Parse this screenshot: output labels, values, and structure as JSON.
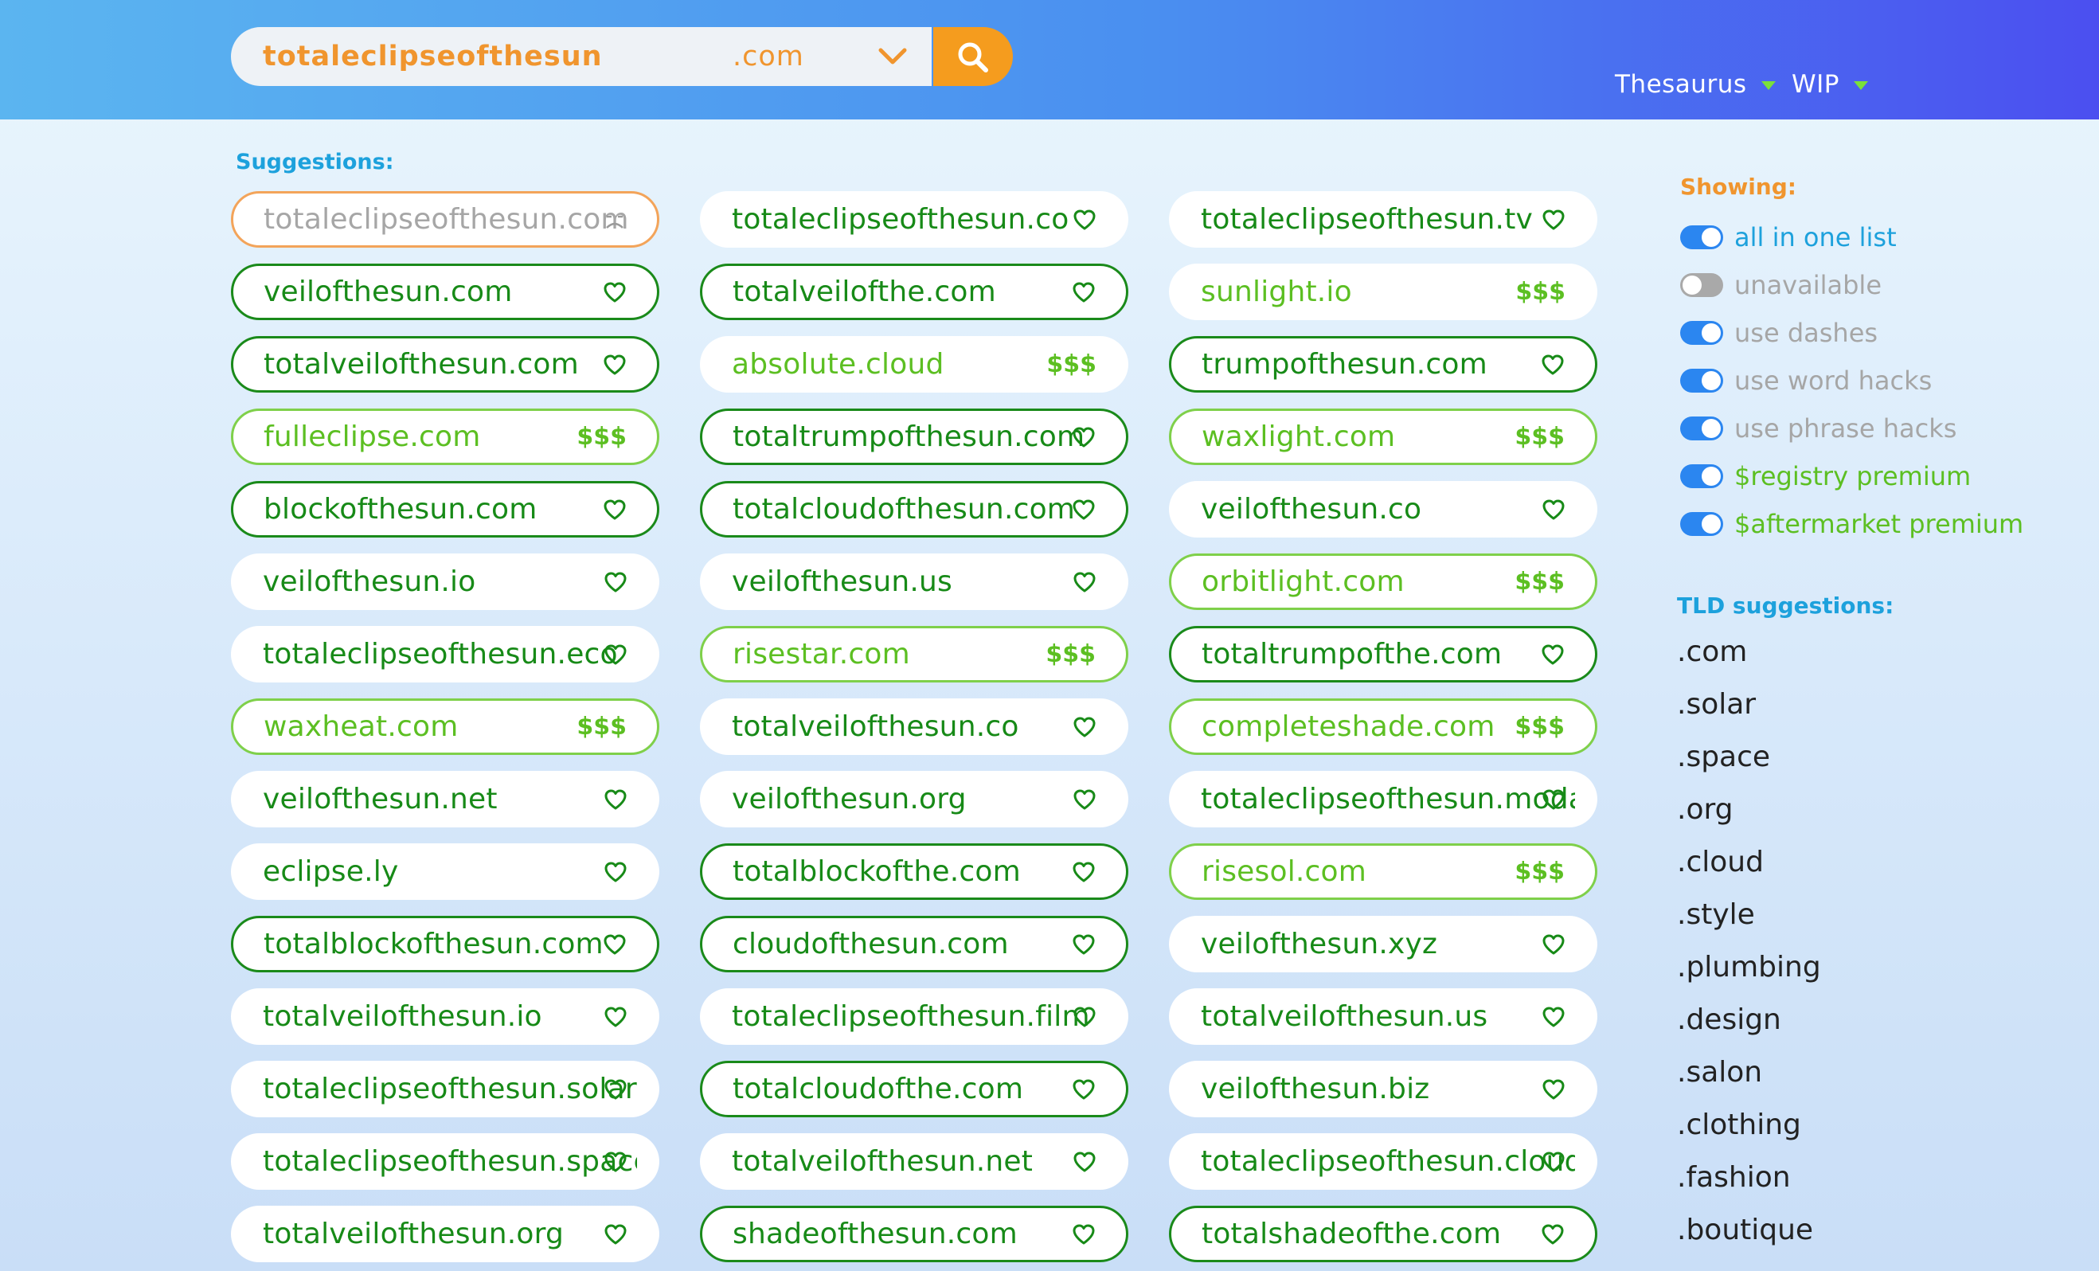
{
  "search": {
    "query": "totaleclipseofthesun",
    "tld": ".com"
  },
  "nav": {
    "thesaurus": "Thesaurus",
    "wip": "WIP"
  },
  "suggestions_label": "Suggestions:",
  "suggestions": [
    {
      "name": "totaleclipseofthesun.com",
      "status": "unavailable",
      "action": "frown-icon"
    },
    {
      "name": "totaleclipseofthesun.co",
      "status": "available",
      "action": "heart-icon"
    },
    {
      "name": "totaleclipseofthesun.tv",
      "status": "available",
      "action": "heart-icon"
    },
    {
      "name": "veilofthesun.com",
      "status": "available-selected",
      "action": "heart-icon"
    },
    {
      "name": "totalveilofthe.com",
      "status": "available-selected",
      "action": "heart-icon"
    },
    {
      "name": "sunlight.io",
      "status": "premium",
      "action": "$$$"
    },
    {
      "name": "totalveilofthesun.com",
      "status": "available-selected",
      "action": "heart-icon"
    },
    {
      "name": "absolute.cloud",
      "status": "premium",
      "action": "$$$"
    },
    {
      "name": "trumpofthesun.com",
      "status": "available-selected",
      "action": "heart-icon"
    },
    {
      "name": "fulleclipse.com",
      "status": "premium-selected",
      "action": "$$$"
    },
    {
      "name": "totaltrumpofthesun.com",
      "status": "available-selected",
      "action": "heart-icon"
    },
    {
      "name": "waxlight.com",
      "status": "premium-selected",
      "action": "$$$"
    },
    {
      "name": "blockofthesun.com",
      "status": "available-selected",
      "action": "heart-icon"
    },
    {
      "name": "totalcloudofthesun.com",
      "status": "available-selected",
      "action": "heart-icon"
    },
    {
      "name": "veilofthesun.co",
      "status": "available",
      "action": "heart-icon"
    },
    {
      "name": "veilofthesun.io",
      "status": "available",
      "action": "heart-icon"
    },
    {
      "name": "veilofthesun.us",
      "status": "available",
      "action": "heart-icon"
    },
    {
      "name": "orbitlight.com",
      "status": "premium-selected",
      "action": "$$$"
    },
    {
      "name": "totaleclipseofthesun.eco",
      "status": "available",
      "action": "heart-icon"
    },
    {
      "name": "risestar.com",
      "status": "premium-selected",
      "action": "$$$"
    },
    {
      "name": "totaltrumpofthe.com",
      "status": "available-selected",
      "action": "heart-icon"
    },
    {
      "name": "waxheat.com",
      "status": "premium-selected",
      "action": "$$$"
    },
    {
      "name": "totalveilofthesun.co",
      "status": "available",
      "action": "heart-icon"
    },
    {
      "name": "completeshade.com",
      "status": "premium-selected",
      "action": "$$$"
    },
    {
      "name": "veilofthesun.net",
      "status": "available",
      "action": "heart-icon"
    },
    {
      "name": "veilofthesun.org",
      "status": "available",
      "action": "heart-icon"
    },
    {
      "name": "totaleclipseofthesun.moda",
      "status": "available",
      "action": "heart-icon"
    },
    {
      "name": "eclipse.ly",
      "status": "available",
      "action": "heart-icon"
    },
    {
      "name": "totalblockofthe.com",
      "status": "available-selected",
      "action": "heart-icon"
    },
    {
      "name": "risesol.com",
      "status": "premium-selected",
      "action": "$$$"
    },
    {
      "name": "totalblockofthesun.com",
      "status": "available-selected",
      "action": "heart-icon"
    },
    {
      "name": "cloudofthesun.com",
      "status": "available-selected",
      "action": "heart-icon"
    },
    {
      "name": "veilofthesun.xyz",
      "status": "available",
      "action": "heart-icon"
    },
    {
      "name": "totalveilofthesun.io",
      "status": "available",
      "action": "heart-icon"
    },
    {
      "name": "totaleclipseofthesun.film",
      "status": "available",
      "action": "heart-icon"
    },
    {
      "name": "totalveilofthesun.us",
      "status": "available",
      "action": "heart-icon"
    },
    {
      "name": "totaleclipseofthesun.solar",
      "status": "available",
      "action": "heart-icon"
    },
    {
      "name": "totalcloudofthe.com",
      "status": "available-selected",
      "action": "heart-icon"
    },
    {
      "name": "veilofthesun.biz",
      "status": "available",
      "action": "heart-icon"
    },
    {
      "name": "totaleclipseofthesun.space",
      "status": "available",
      "action": "heart-icon"
    },
    {
      "name": "totalveilofthesun.net",
      "status": "available",
      "action": "heart-icon"
    },
    {
      "name": "totaleclipseofthesun.cloud",
      "status": "available",
      "action": "heart-icon"
    },
    {
      "name": "totalveilofthesun.org",
      "status": "available",
      "action": "heart-icon"
    },
    {
      "name": "shadeofthesun.com",
      "status": "available-selected",
      "action": "heart-icon"
    },
    {
      "name": "totalshadeofthe.com",
      "status": "available-selected",
      "action": "heart-icon"
    }
  ],
  "showing": {
    "label": "Showing:",
    "options": [
      {
        "label": "all in one list",
        "on": true,
        "color": "#1da1dc"
      },
      {
        "label": "unavailable",
        "on": false,
        "color": "#a6a6a6"
      },
      {
        "label": "use dashes",
        "on": true,
        "color": "#a6a6a6"
      },
      {
        "label": "use word hacks",
        "on": true,
        "color": "#a6a6a6"
      },
      {
        "label": "use phrase hacks",
        "on": true,
        "color": "#a6a6a6"
      },
      {
        "label": "$registry premium",
        "on": true,
        "color": "#5cbf22"
      },
      {
        "label": "$aftermarket premium",
        "on": true,
        "color": "#5cbf22"
      }
    ]
  },
  "tld_suggestions": {
    "label": "TLD suggestions:",
    "items": [
      ".com",
      ".solar",
      ".space",
      ".org",
      ".cloud",
      ".style",
      ".plumbing",
      ".design",
      ".salon",
      ".clothing",
      ".fashion",
      ".boutique"
    ]
  },
  "colors": {
    "accent_orange": "#f59c1e",
    "green_dark": "#178a17",
    "green_light": "#5cbf22",
    "blue_label": "#1da1dc",
    "toggle_on": "#2b86f0"
  }
}
